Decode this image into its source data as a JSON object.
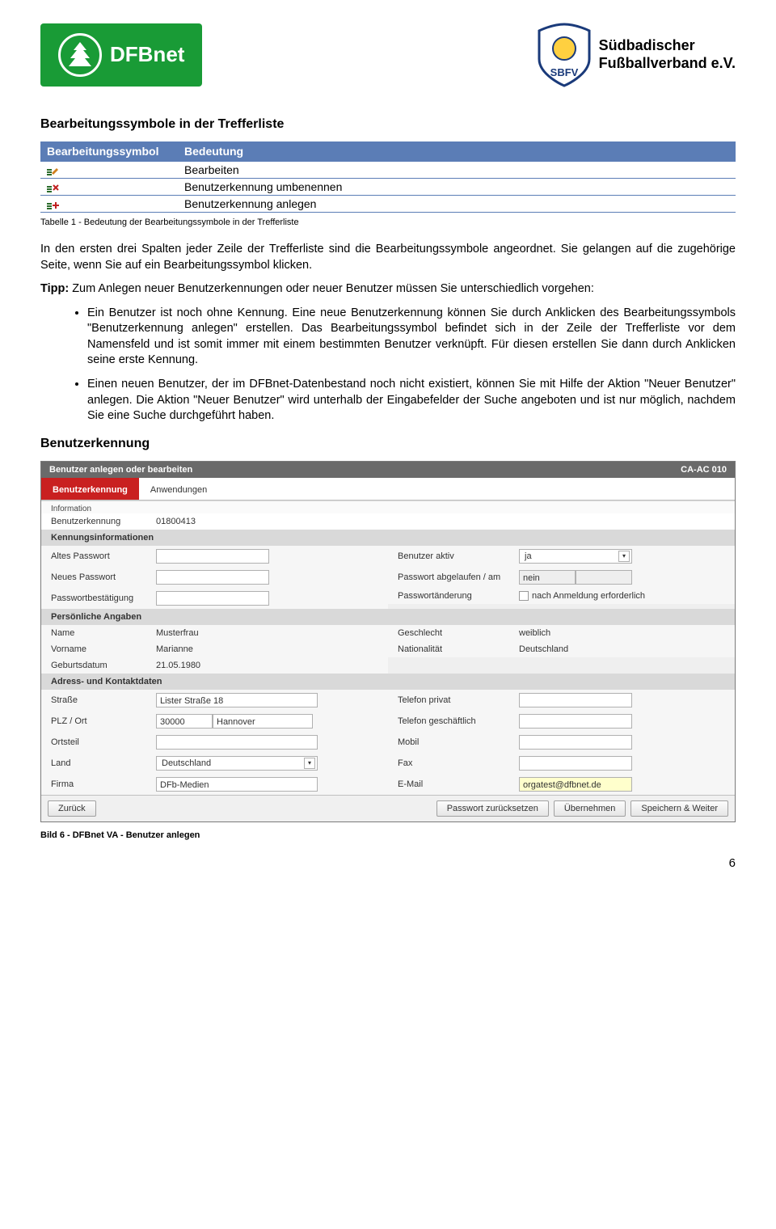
{
  "header": {
    "logo_left": "DFBnet",
    "logo_right_line1": "Südbadischer",
    "logo_right_line2": "Fußballverband e.V.",
    "logo_right_abbrev": "SBFV"
  },
  "section1_title": "Bearbeitungssymbole in der Trefferliste",
  "symbols_table": {
    "col1": "Bearbeitungssymbol",
    "col2": "Bedeutung",
    "rows": [
      {
        "meaning": "Bearbeiten"
      },
      {
        "meaning": "Benutzerkennung umbenennen"
      },
      {
        "meaning": "Benutzerkennung anlegen"
      }
    ]
  },
  "table_caption": "Tabelle 1 - Bedeutung der Bearbeitungssymbole in der Trefferliste",
  "para1": "In den ersten drei Spalten jeder Zeile der Trefferliste sind die Bearbeitungssymbole angeordnet. Sie gelangen auf die zugehörige Seite, wenn Sie auf ein Bearbeitungssymbol klicken.",
  "tipp_label": "Tipp:",
  "tipp_text": " Zum Anlegen neuer Benutzerkennungen oder neuer Benutzer müssen Sie unterschiedlich vorgehen:",
  "bullet1": "Ein Benutzer ist noch ohne Kennung. Eine neue Benutzerkennung können Sie durch Anklicken des Bearbeitungssymbols \"Benutzerkennung anlegen\" erstellen. Das Bearbeitungssymbol befindet sich in der Zeile der Trefferliste vor dem Namensfeld und ist somit immer mit einem bestimmten Benutzer verknüpft. Für diesen erstellen Sie dann durch Anklicken seine erste Kennung.",
  "bullet2": "Einen neuen Benutzer, der im DFBnet-Datenbestand noch nicht existiert, können Sie mit Hilfe der Aktion \"Neuer Benutzer\" anlegen. Die Aktion \"Neuer Benutzer\" wird unterhalb der Eingabefelder der Suche angeboten und ist nur möglich, nachdem Sie eine Suche durchgeführt haben.",
  "section2_title": "Benutzerkennung",
  "screenshot": {
    "title": "Benutzer anlegen oder bearbeiten",
    "title_code": "CA-AC 010",
    "tab1": "Benutzerkennung",
    "tab2": "Anwendungen",
    "info_label": "Information",
    "bk_label": "Benutzerkennung",
    "bk_value": "01800413",
    "sec_kennung": "Kennungsinformationen",
    "altes_pw": "Altes Passwort",
    "neues_pw": "Neues Passwort",
    "pw_best": "Passwortbestätigung",
    "ben_aktiv": "Benutzer aktiv",
    "ben_aktiv_val": "ja",
    "pw_abg": "Passwort abgelaufen / am",
    "pw_abg_val": "nein",
    "pw_aend": "Passwortänderung",
    "pw_aend_val": "nach Anmeldung erforderlich",
    "sec_pers": "Persönliche Angaben",
    "name_l": "Name",
    "name_v": "Musterfrau",
    "vorname_l": "Vorname",
    "vorname_v": "Marianne",
    "geb_l": "Geburtsdatum",
    "geb_v": "21.05.1980",
    "geschl_l": "Geschlecht",
    "geschl_v": "weiblich",
    "nat_l": "Nationalität",
    "nat_v": "Deutschland",
    "sec_addr": "Adress- und Kontaktdaten",
    "str_l": "Straße",
    "str_v": "Lister Straße 18",
    "plz_l": "PLZ / Ort",
    "plz_v": "30000",
    "ort_v": "Hannover",
    "ortsteil_l": "Ortsteil",
    "land_l": "Land",
    "land_v": "Deutschland",
    "firma_l": "Firma",
    "firma_v": "DFb-Medien",
    "tel_priv_l": "Telefon privat",
    "tel_ges_l": "Telefon geschäftlich",
    "mobil_l": "Mobil",
    "fax_l": "Fax",
    "email_l": "E-Mail",
    "email_v": "orgatest@dfbnet.de",
    "btn_back": "Zurück",
    "btn_pwreset": "Passwort zurücksetzen",
    "btn_save": "Übernehmen",
    "btn_savenext": "Speichern & Weiter"
  },
  "fig_caption": "Bild 6 - DFBnet VA - Benutzer anlegen",
  "page_number": "6"
}
